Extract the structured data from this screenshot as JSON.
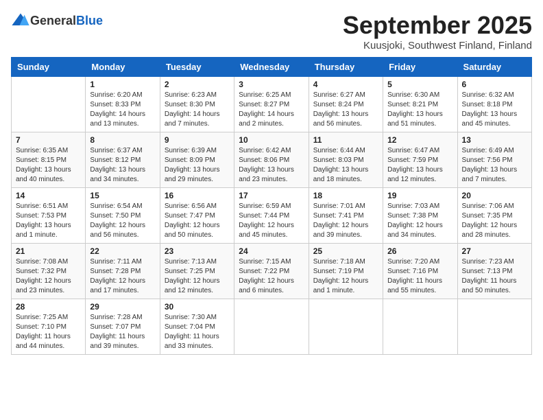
{
  "header": {
    "logo_general": "General",
    "logo_blue": "Blue",
    "month_title": "September 2025",
    "location": "Kuusjoki, Southwest Finland, Finland"
  },
  "days_of_week": [
    "Sunday",
    "Monday",
    "Tuesday",
    "Wednesday",
    "Thursday",
    "Friday",
    "Saturday"
  ],
  "weeks": [
    [
      {
        "day": "",
        "info": ""
      },
      {
        "day": "1",
        "info": "Sunrise: 6:20 AM\nSunset: 8:33 PM\nDaylight: 14 hours\nand 13 minutes."
      },
      {
        "day": "2",
        "info": "Sunrise: 6:23 AM\nSunset: 8:30 PM\nDaylight: 14 hours\nand 7 minutes."
      },
      {
        "day": "3",
        "info": "Sunrise: 6:25 AM\nSunset: 8:27 PM\nDaylight: 14 hours\nand 2 minutes."
      },
      {
        "day": "4",
        "info": "Sunrise: 6:27 AM\nSunset: 8:24 PM\nDaylight: 13 hours\nand 56 minutes."
      },
      {
        "day": "5",
        "info": "Sunrise: 6:30 AM\nSunset: 8:21 PM\nDaylight: 13 hours\nand 51 minutes."
      },
      {
        "day": "6",
        "info": "Sunrise: 6:32 AM\nSunset: 8:18 PM\nDaylight: 13 hours\nand 45 minutes."
      }
    ],
    [
      {
        "day": "7",
        "info": "Sunrise: 6:35 AM\nSunset: 8:15 PM\nDaylight: 13 hours\nand 40 minutes."
      },
      {
        "day": "8",
        "info": "Sunrise: 6:37 AM\nSunset: 8:12 PM\nDaylight: 13 hours\nand 34 minutes."
      },
      {
        "day": "9",
        "info": "Sunrise: 6:39 AM\nSunset: 8:09 PM\nDaylight: 13 hours\nand 29 minutes."
      },
      {
        "day": "10",
        "info": "Sunrise: 6:42 AM\nSunset: 8:06 PM\nDaylight: 13 hours\nand 23 minutes."
      },
      {
        "day": "11",
        "info": "Sunrise: 6:44 AM\nSunset: 8:03 PM\nDaylight: 13 hours\nand 18 minutes."
      },
      {
        "day": "12",
        "info": "Sunrise: 6:47 AM\nSunset: 7:59 PM\nDaylight: 13 hours\nand 12 minutes."
      },
      {
        "day": "13",
        "info": "Sunrise: 6:49 AM\nSunset: 7:56 PM\nDaylight: 13 hours\nand 7 minutes."
      }
    ],
    [
      {
        "day": "14",
        "info": "Sunrise: 6:51 AM\nSunset: 7:53 PM\nDaylight: 13 hours\nand 1 minute."
      },
      {
        "day": "15",
        "info": "Sunrise: 6:54 AM\nSunset: 7:50 PM\nDaylight: 12 hours\nand 56 minutes."
      },
      {
        "day": "16",
        "info": "Sunrise: 6:56 AM\nSunset: 7:47 PM\nDaylight: 12 hours\nand 50 minutes."
      },
      {
        "day": "17",
        "info": "Sunrise: 6:59 AM\nSunset: 7:44 PM\nDaylight: 12 hours\nand 45 minutes."
      },
      {
        "day": "18",
        "info": "Sunrise: 7:01 AM\nSunset: 7:41 PM\nDaylight: 12 hours\nand 39 minutes."
      },
      {
        "day": "19",
        "info": "Sunrise: 7:03 AM\nSunset: 7:38 PM\nDaylight: 12 hours\nand 34 minutes."
      },
      {
        "day": "20",
        "info": "Sunrise: 7:06 AM\nSunset: 7:35 PM\nDaylight: 12 hours\nand 28 minutes."
      }
    ],
    [
      {
        "day": "21",
        "info": "Sunrise: 7:08 AM\nSunset: 7:32 PM\nDaylight: 12 hours\nand 23 minutes."
      },
      {
        "day": "22",
        "info": "Sunrise: 7:11 AM\nSunset: 7:28 PM\nDaylight: 12 hours\nand 17 minutes."
      },
      {
        "day": "23",
        "info": "Sunrise: 7:13 AM\nSunset: 7:25 PM\nDaylight: 12 hours\nand 12 minutes."
      },
      {
        "day": "24",
        "info": "Sunrise: 7:15 AM\nSunset: 7:22 PM\nDaylight: 12 hours\nand 6 minutes."
      },
      {
        "day": "25",
        "info": "Sunrise: 7:18 AM\nSunset: 7:19 PM\nDaylight: 12 hours\nand 1 minute."
      },
      {
        "day": "26",
        "info": "Sunrise: 7:20 AM\nSunset: 7:16 PM\nDaylight: 11 hours\nand 55 minutes."
      },
      {
        "day": "27",
        "info": "Sunrise: 7:23 AM\nSunset: 7:13 PM\nDaylight: 11 hours\nand 50 minutes."
      }
    ],
    [
      {
        "day": "28",
        "info": "Sunrise: 7:25 AM\nSunset: 7:10 PM\nDaylight: 11 hours\nand 44 minutes."
      },
      {
        "day": "29",
        "info": "Sunrise: 7:28 AM\nSunset: 7:07 PM\nDaylight: 11 hours\nand 39 minutes."
      },
      {
        "day": "30",
        "info": "Sunrise: 7:30 AM\nSunset: 7:04 PM\nDaylight: 11 hours\nand 33 minutes."
      },
      {
        "day": "",
        "info": ""
      },
      {
        "day": "",
        "info": ""
      },
      {
        "day": "",
        "info": ""
      },
      {
        "day": "",
        "info": ""
      }
    ]
  ]
}
